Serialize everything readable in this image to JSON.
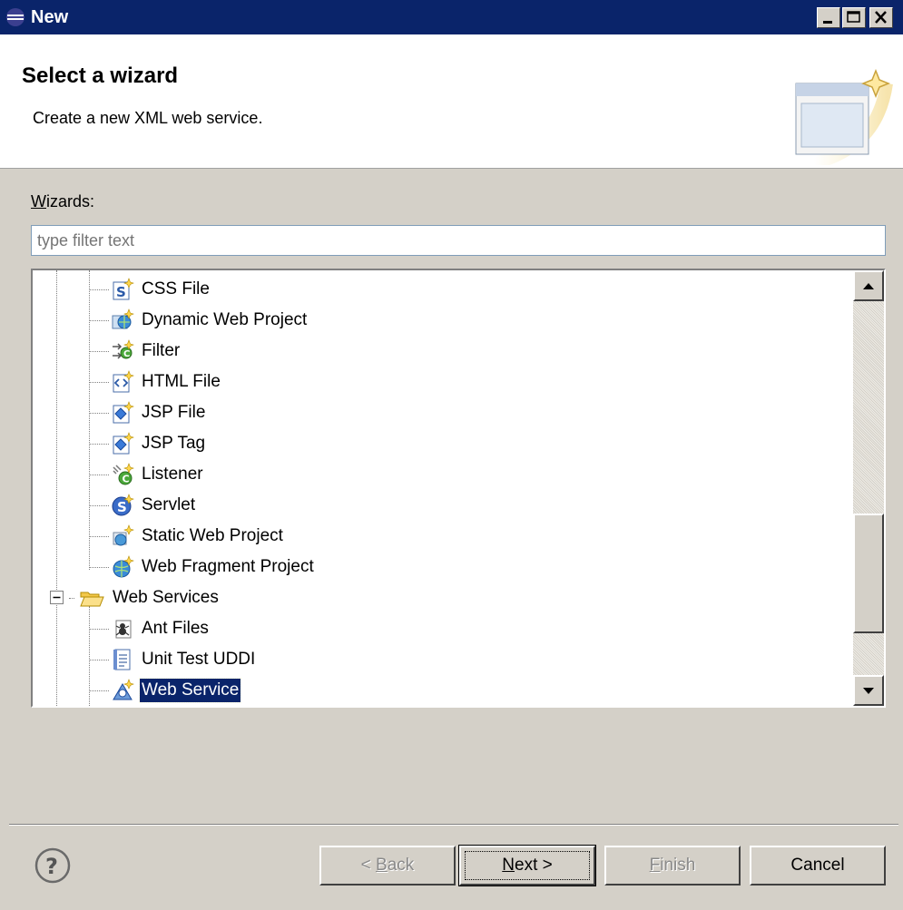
{
  "window": {
    "title": "New",
    "controls": [
      "minimize",
      "maximize",
      "close"
    ]
  },
  "header": {
    "title": "Select a wizard",
    "description": "Create a new XML web service."
  },
  "wizards": {
    "label_prefix": "W",
    "label_rest": "izards:",
    "filter_placeholder": "type filter text"
  },
  "tree": {
    "items": [
      {
        "label": "CSS File",
        "icon": "css-file-icon"
      },
      {
        "label": "Dynamic Web Project",
        "icon": "dynamic-web-project-icon"
      },
      {
        "label": "Filter",
        "icon": "filter-icon"
      },
      {
        "label": "HTML File",
        "icon": "html-file-icon"
      },
      {
        "label": "JSP File",
        "icon": "jsp-file-icon"
      },
      {
        "label": "JSP Tag",
        "icon": "jsp-tag-icon"
      },
      {
        "label": "Listener",
        "icon": "listener-icon"
      },
      {
        "label": "Servlet",
        "icon": "servlet-icon"
      },
      {
        "label": "Static Web Project",
        "icon": "static-web-project-icon"
      },
      {
        "label": "Web Fragment Project",
        "icon": "web-fragment-project-icon"
      },
      {
        "label": "Web Services",
        "icon": "folder-open-icon",
        "expanded": true
      },
      {
        "label": "Ant Files",
        "icon": "ant-files-icon"
      },
      {
        "label": "Unit Test UDDI",
        "icon": "unit-test-uddi-icon"
      },
      {
        "label": "Web Service",
        "icon": "web-service-icon",
        "selected": true
      }
    ]
  },
  "buttons": {
    "back": {
      "pre": "< ",
      "mnemonic": "B",
      "rest": "ack",
      "enabled": false
    },
    "next": {
      "pre": "",
      "mnemonic": "N",
      "rest": "ext >",
      "enabled": true
    },
    "finish": {
      "pre": "",
      "mnemonic": "F",
      "rest": "inish",
      "enabled": false
    },
    "cancel": {
      "label": "Cancel",
      "enabled": true
    }
  },
  "colors": {
    "titlebar": "#0a246a",
    "dialog_bg": "#d4d0c8",
    "selection": "#0a246a"
  }
}
